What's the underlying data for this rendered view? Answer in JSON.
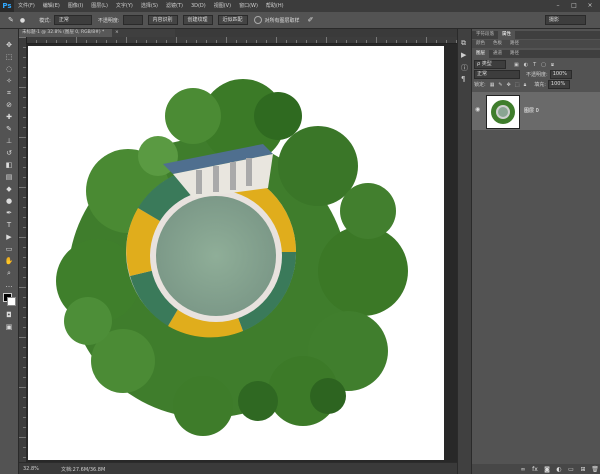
{
  "menubar": {
    "logo": "Ps",
    "items": [
      "文件(F)",
      "编辑(E)",
      "图像(I)",
      "图层(L)",
      "文字(Y)",
      "选择(S)",
      "滤镜(T)",
      "3D(D)",
      "视图(V)",
      "窗口(W)",
      "帮助(H)"
    ],
    "minimize": "–",
    "maximize": "□",
    "close": "×"
  },
  "options": {
    "mode_label": "模式:",
    "mode_value": "正常",
    "opacity_label": "不透明度:",
    "btn1": "内容识别",
    "btn2": "创建纹理",
    "btn3": "近似匹配",
    "sample_all": "对所有图层取样",
    "workspace": "摄影"
  },
  "document": {
    "tab1": "未标题-1 @ 32.8% (图层 0, RGB/8#) *",
    "tab2": "×",
    "status_zoom": "32.8%",
    "status_doc": "文档:27.6M/36.8M"
  },
  "panels": {
    "top_tabs": [
      "字符段落",
      "属性"
    ],
    "sub_tabs": [
      "颜色",
      "色板",
      "路径"
    ],
    "layers_tabs": [
      "图层",
      "通道",
      "路径"
    ],
    "filter_label": "ρ 类型",
    "blend_mode": "正常",
    "opacity_label": "不透明度:",
    "opacity_value": "100%",
    "lock_label": "锁定:",
    "fill_label": "填充:",
    "fill_value": "100%",
    "layer_name": "图层 0"
  },
  "colors": {
    "sky": "#ffffff",
    "trees": "#3d7a2a",
    "field": "#8aa592",
    "stand_yellow": "#e0ad1c",
    "stand_green": "#3a7a5a"
  }
}
